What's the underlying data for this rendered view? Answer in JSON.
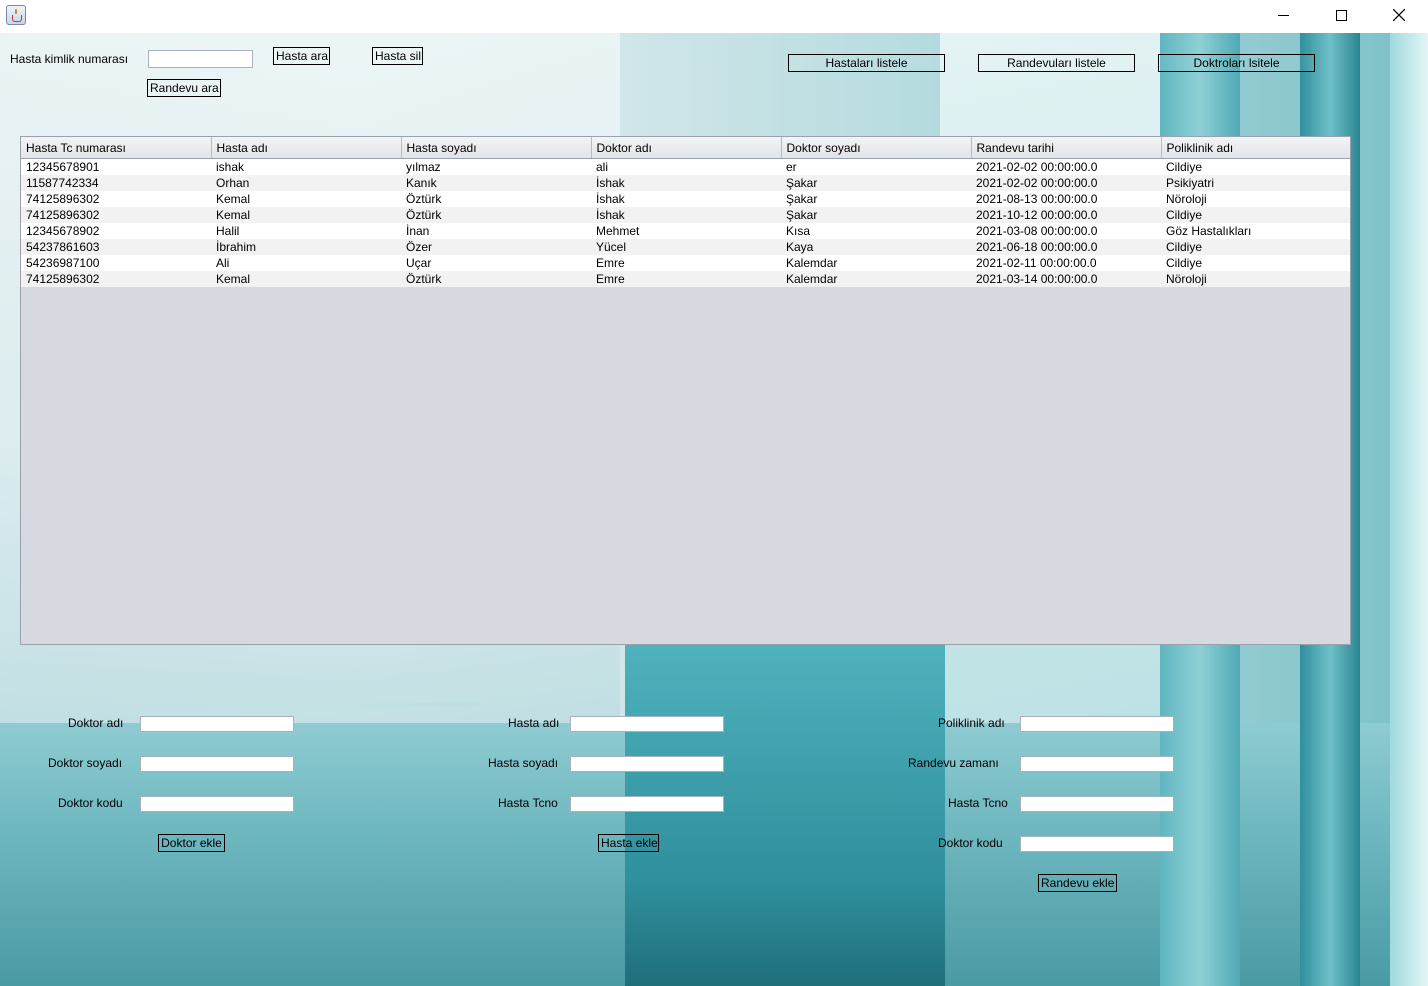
{
  "window": {
    "minimize": "minimize",
    "maximize": "maximize",
    "close": "close"
  },
  "search": {
    "label": "Hasta kimlik numarası",
    "value": "",
    "search_button": "Hasta ara",
    "delete_button": "Hasta sil",
    "appointment_search_button": "Randevu ara"
  },
  "top_buttons": {
    "list_patients": "Hastaları listele",
    "list_appointments": "Randevuları listele",
    "list_doctors": "Doktroları lsitele"
  },
  "table": {
    "columns": [
      "Hasta Tc numarası",
      "Hasta adı",
      "Hasta soyadı",
      "Doktor adı",
      "Doktor soyadı",
      "Randevu tarihi",
      "Poliklinik adı"
    ],
    "rows": [
      [
        "12345678901",
        "ishak",
        "yılmaz",
        "ali",
        "er",
        "2021-02-02 00:00:00.0",
        "Cildiye"
      ],
      [
        "11587742334",
        "Orhan",
        "Kanık",
        "İshak",
        "Şakar",
        "2021-02-02 00:00:00.0",
        "Psikiyatri"
      ],
      [
        "74125896302",
        "Kemal",
        "Öztürk",
        "İshak",
        "Şakar",
        "2021-08-13 00:00:00.0",
        "Nöroloji"
      ],
      [
        "74125896302",
        "Kemal",
        "Öztürk",
        "İshak",
        "Şakar",
        "2021-10-12 00:00:00.0",
        "Cildiye"
      ],
      [
        "12345678902",
        "Halil",
        "İnan",
        "Mehmet",
        "Kısa",
        "2021-03-08 00:00:00.0",
        "Göz Hastalıkları"
      ],
      [
        "54237861603",
        "İbrahim",
        "Özer",
        "Yücel",
        "Kaya",
        "2021-06-18 00:00:00.0",
        "Cildiye"
      ],
      [
        "54236987100",
        "Ali",
        "Uçar",
        "Emre",
        "Kalemdar",
        "2021-02-11 00:00:00.0",
        "Cildiye"
      ],
      [
        "74125896302",
        "Kemal",
        "Öztürk",
        "Emre",
        "Kalemdar",
        "2021-03-14 00:00:00.0",
        "Nöroloji"
      ]
    ]
  },
  "doctor_form": {
    "name_label": "Doktor adı",
    "surname_label": "Doktor soyadı",
    "code_label": "Doktor kodu",
    "name_value": "",
    "surname_value": "",
    "code_value": "",
    "add_button": "Doktor ekle"
  },
  "patient_form": {
    "name_label": "Hasta adı",
    "surname_label": "Hasta soyadı",
    "tcno_label": "Hasta Tcno",
    "name_value": "",
    "surname_value": "",
    "tcno_value": "",
    "add_button": "Hasta ekle"
  },
  "appointment_form": {
    "clinic_label": "Poliklinik adı",
    "time_label": "Randevu zamanı",
    "tcno_label": "Hasta Tcno",
    "doctor_code_label": "Doktor kodu",
    "clinic_value": "",
    "time_value": "",
    "tcno_value": "",
    "doctor_code_value": "",
    "add_button": "Randevu ekle"
  }
}
